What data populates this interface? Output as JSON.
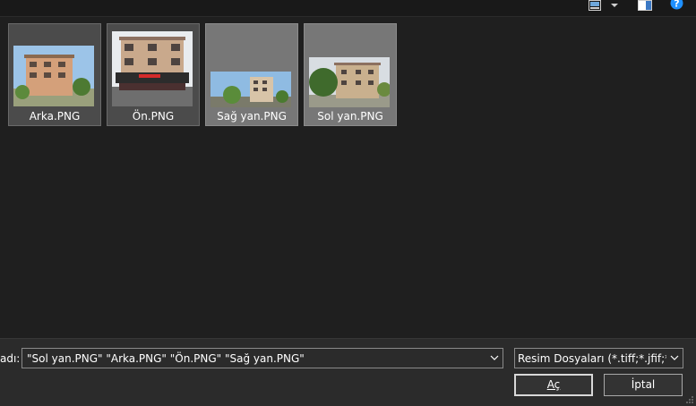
{
  "toolbar": {
    "view_icon": "change-view-icon",
    "view_dropdown_icon": "chevron-down-icon",
    "preview_pane_icon": "preview-pane-icon",
    "help_icon": "help-icon"
  },
  "files": [
    {
      "name": "Arka.PNG",
      "selected": false
    },
    {
      "name": "Ön.PNG",
      "selected": false
    },
    {
      "name": "Sağ yan.PNG",
      "selected": true
    },
    {
      "name": "Sol yan.PNG",
      "selected": true
    }
  ],
  "footer": {
    "filename_label": "adı:",
    "filename_value": "\"Sol yan.PNG\" \"Arka.PNG\" \"Ön.PNG\" \"Sağ yan.PNG\"",
    "filetype_value": "Resim Dosyaları (*.tiff;*.jfif;*.bmp",
    "open_label": "Aç",
    "cancel_label": "İptal"
  },
  "colors": {
    "background": "#1f1f1f",
    "footer_bg": "#2b2b2b",
    "tile_bg": "#4b4b4b",
    "tile_selected_bg": "#777777",
    "help_blue": "#1e90ff"
  }
}
